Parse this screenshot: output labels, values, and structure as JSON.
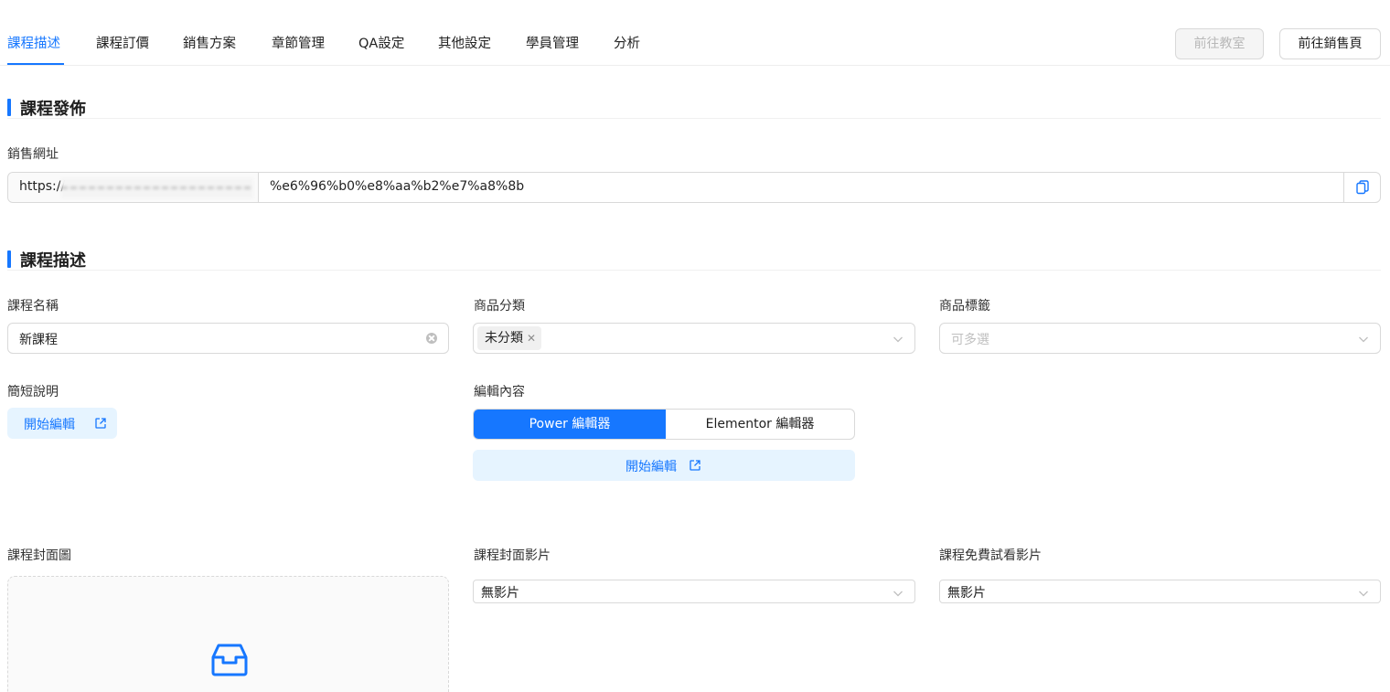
{
  "tabs": [
    {
      "label": "課程描述",
      "active": true
    },
    {
      "label": "課程訂價"
    },
    {
      "label": "銷售方案"
    },
    {
      "label": "章節管理"
    },
    {
      "label": "QA設定"
    },
    {
      "label": "其他設定"
    },
    {
      "label": "學員管理"
    },
    {
      "label": "分析"
    }
  ],
  "actions": {
    "goto_classroom": "前往教室",
    "goto_sales_page": "前往銷售頁"
  },
  "publish": {
    "section_title": "課程發佈",
    "sales_url_label": "銷售網址",
    "url_prefix": "https://",
    "url_value": "%e6%96%b0%e8%aa%b2%e7%a8%8b"
  },
  "description": {
    "section_title": "課程描述",
    "course_name_label": "課程名稱",
    "course_name_value": "新課程",
    "category_label": "商品分類",
    "category_tag": "未分類",
    "tags_label": "商品標籤",
    "tags_placeholder": "可多選",
    "short_desc_label": "簡短說明",
    "start_edit": "開始編輯",
    "content_label": "編輯內容",
    "editor_power": "Power 編輯器",
    "editor_elementor": "Elementor 編輯器",
    "content_start_edit": "開始編輯",
    "cover_image_label": "課程封面圖",
    "cover_video_label": "課程封面影片",
    "cover_video_value": "無影片",
    "trial_video_label": "課程免費試看影片",
    "trial_video_value": "無影片"
  },
  "colors": {
    "accent": "#1677ff",
    "accent_light": "#e6f4ff"
  }
}
